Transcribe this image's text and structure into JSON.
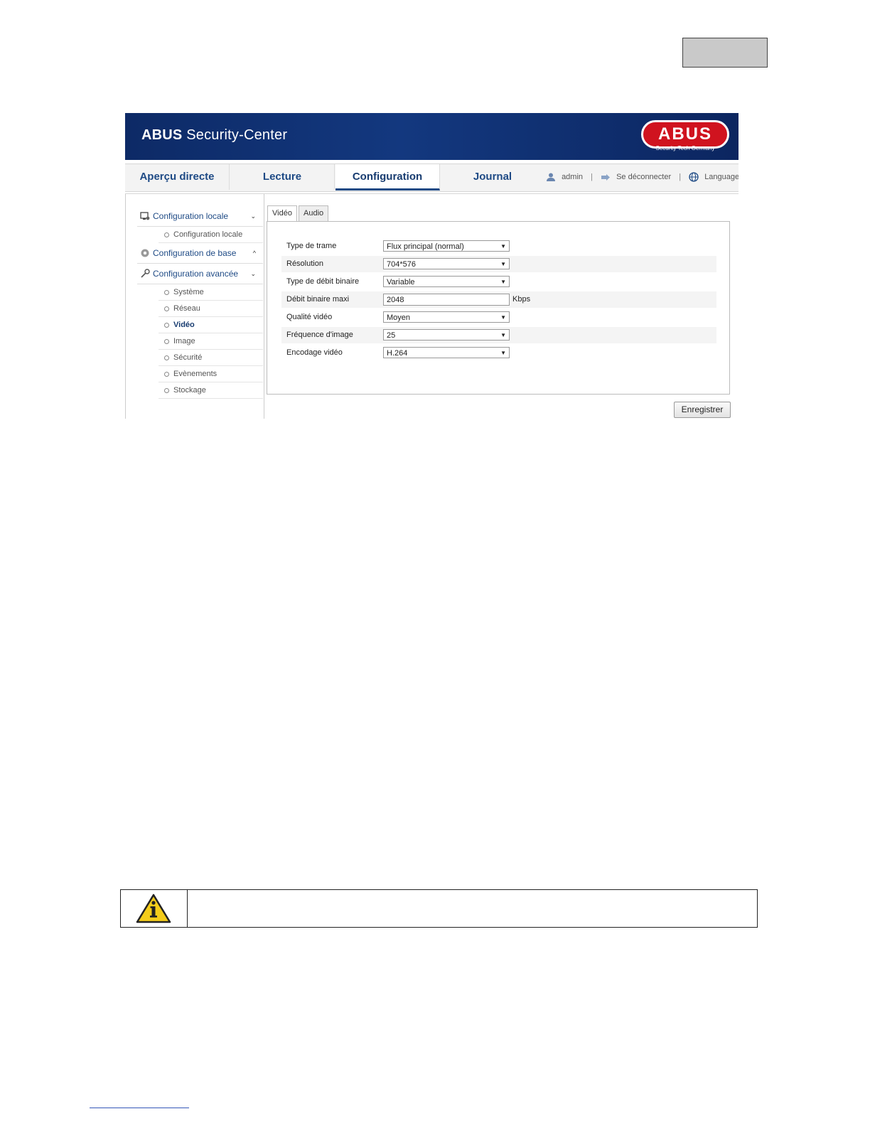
{
  "header": {
    "brand_bold": "ABUS",
    "brand_rest": " Security-Center",
    "logo_text": "ABUS",
    "logo_subtext": "Security Tech Germany"
  },
  "nav": {
    "tabs": [
      {
        "label": "Aperçu directe"
      },
      {
        "label": "Lecture"
      },
      {
        "label": "Configuration",
        "active": true
      },
      {
        "label": "Journal"
      }
    ],
    "user": "admin",
    "logout": "Se déconnecter",
    "language": "Language",
    "separator": "|"
  },
  "sidebar": {
    "local_config": {
      "label": "Configuration locale",
      "chevron": "⌄"
    },
    "local_config_items": [
      "Configuration locale"
    ],
    "base_config": {
      "label": "Configuration de base",
      "chevron": "^"
    },
    "advanced_config": {
      "label": "Configuration avancée",
      "chevron": "⌄"
    },
    "advanced_items": [
      "Système",
      "Réseau",
      "Vidéo",
      "Image",
      "Sécurité",
      "Evènements",
      "Stockage"
    ],
    "active_item": "Vidéo"
  },
  "subtabs": [
    "Vidéo",
    "Audio"
  ],
  "form": {
    "stream_type": {
      "label": "Type de trame",
      "value": "Flux principal (normal)"
    },
    "resolution": {
      "label": "Résolution",
      "value": "704*576"
    },
    "bitrate_type": {
      "label": "Type de débit binaire",
      "value": "Variable"
    },
    "max_bitrate": {
      "label": "Débit binaire maxi",
      "value": "2048",
      "unit": "Kbps"
    },
    "video_quality": {
      "label": "Qualité vidéo",
      "value": "Moyen"
    },
    "frame_rate": {
      "label": "Fréquence d'image",
      "value": "25"
    },
    "video_encoding": {
      "label": "Encodage vidéo",
      "value": "H.264"
    }
  },
  "save_label": "Enregistrer",
  "colors": {
    "brand_blue": "#1e4a85",
    "banner_navy": "#0d2a66",
    "logo_red": "#d0131f"
  }
}
